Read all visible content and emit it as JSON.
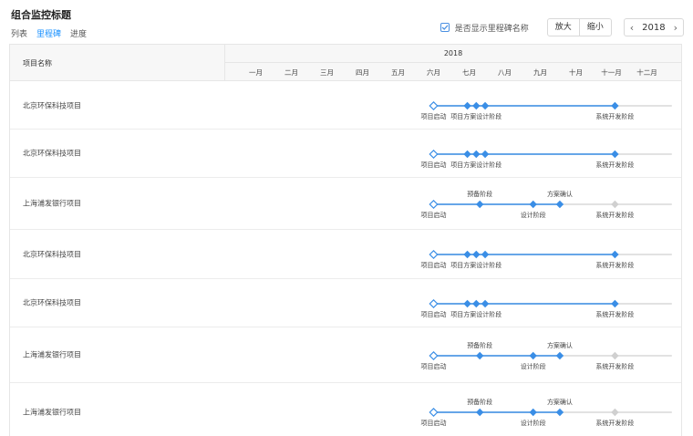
{
  "page_title": "组合监控标题",
  "tabs": [
    {
      "label": "列表",
      "active": false
    },
    {
      "label": "里程碑",
      "active": true
    },
    {
      "label": "进度",
      "active": false
    }
  ],
  "toolbar": {
    "show_milestone_names_label": "是否显示里程碑名称",
    "show_milestone_names_checked": true,
    "zoom_in_label": "放大",
    "zoom_out_label": "缩小",
    "prev_icon": "chevron-left-icon",
    "next_icon": "chevron-right-icon",
    "year": "2018"
  },
  "table": {
    "name_header": "项目名称",
    "year_header": "2018",
    "months": [
      "一月",
      "二月",
      "三月",
      "四月",
      "五月",
      "六月",
      "七月",
      "八月",
      "九月",
      "十月",
      "十一月",
      "十二月"
    ]
  },
  "colors": {
    "accent": "#1890ff",
    "milestone_done": "#3a8ee6",
    "milestone_pending": "#d0d0d0",
    "track_pending": "#d9d9d9"
  },
  "rows": [
    {
      "name": "北京环保科技项目",
      "progress_month": 10.6,
      "milestones": [
        {
          "month": 5.5,
          "status": "start",
          "label": "项目启动",
          "label_pos": "below"
        },
        {
          "month": 6.45,
          "status": "done",
          "label": "",
          "label_pos": "below"
        },
        {
          "month": 6.7,
          "status": "done",
          "label": "项目方案设计阶段",
          "label_pos": "below"
        },
        {
          "month": 6.95,
          "status": "done",
          "label": "",
          "label_pos": "below"
        },
        {
          "month": 10.6,
          "status": "done",
          "label": "系统开发阶段",
          "label_pos": "below"
        }
      ]
    },
    {
      "name": "北京环保科技项目",
      "progress_month": 10.6,
      "milestones": [
        {
          "month": 5.5,
          "status": "start",
          "label": "项目启动",
          "label_pos": "below"
        },
        {
          "month": 6.45,
          "status": "done",
          "label": "",
          "label_pos": "below"
        },
        {
          "month": 6.7,
          "status": "done",
          "label": "项目方案设计阶段",
          "label_pos": "below"
        },
        {
          "month": 6.95,
          "status": "done",
          "label": "",
          "label_pos": "below"
        },
        {
          "month": 10.6,
          "status": "done",
          "label": "系统开发阶段",
          "label_pos": "below"
        }
      ]
    },
    {
      "name": "上海浦发银行项目",
      "progress_month": 9.05,
      "milestones": [
        {
          "month": 5.5,
          "status": "start",
          "label": "项目启动",
          "label_pos": "below"
        },
        {
          "month": 6.8,
          "status": "done",
          "label": "预备阶段",
          "label_pos": "above"
        },
        {
          "month": 8.3,
          "status": "done",
          "label": "设计阶段",
          "label_pos": "below"
        },
        {
          "month": 9.05,
          "status": "done",
          "label": "方案确认",
          "label_pos": "above"
        },
        {
          "month": 10.6,
          "status": "pending",
          "label": "系统开发阶段",
          "label_pos": "below"
        }
      ]
    },
    {
      "name": "北京环保科技项目",
      "progress_month": 10.6,
      "milestones": [
        {
          "month": 5.5,
          "status": "start",
          "label": "项目启动",
          "label_pos": "below"
        },
        {
          "month": 6.45,
          "status": "done",
          "label": "",
          "label_pos": "below"
        },
        {
          "month": 6.7,
          "status": "done",
          "label": "项目方案设计阶段",
          "label_pos": "below"
        },
        {
          "month": 6.95,
          "status": "done",
          "label": "",
          "label_pos": "below"
        },
        {
          "month": 10.6,
          "status": "done",
          "label": "系统开发阶段",
          "label_pos": "below"
        }
      ]
    },
    {
      "name": "北京环保科技项目",
      "progress_month": 10.6,
      "milestones": [
        {
          "month": 5.5,
          "status": "start",
          "label": "项目启动",
          "label_pos": "below"
        },
        {
          "month": 6.45,
          "status": "done",
          "label": "",
          "label_pos": "below"
        },
        {
          "month": 6.7,
          "status": "done",
          "label": "项目方案设计阶段",
          "label_pos": "below"
        },
        {
          "month": 6.95,
          "status": "done",
          "label": "",
          "label_pos": "below"
        },
        {
          "month": 10.6,
          "status": "done",
          "label": "系统开发阶段",
          "label_pos": "below"
        }
      ]
    },
    {
      "name": "上海浦发银行项目",
      "progress_month": 9.05,
      "milestones": [
        {
          "month": 5.5,
          "status": "start",
          "label": "项目启动",
          "label_pos": "below"
        },
        {
          "month": 6.8,
          "status": "done",
          "label": "预备阶段",
          "label_pos": "above"
        },
        {
          "month": 8.3,
          "status": "done",
          "label": "设计阶段",
          "label_pos": "below"
        },
        {
          "month": 9.05,
          "status": "done",
          "label": "方案确认",
          "label_pos": "above"
        },
        {
          "month": 10.6,
          "status": "pending",
          "label": "系统开发阶段",
          "label_pos": "below"
        }
      ]
    },
    {
      "name": "上海浦发银行项目",
      "progress_month": 9.05,
      "milestones": [
        {
          "month": 5.5,
          "status": "start",
          "label": "项目启动",
          "label_pos": "below"
        },
        {
          "month": 6.8,
          "status": "done",
          "label": "预备阶段",
          "label_pos": "above"
        },
        {
          "month": 8.3,
          "status": "done",
          "label": "设计阶段",
          "label_pos": "below"
        },
        {
          "month": 9.05,
          "status": "done",
          "label": "方案确认",
          "label_pos": "above"
        },
        {
          "month": 10.6,
          "status": "pending",
          "label": "系统开发阶段",
          "label_pos": "below"
        }
      ]
    }
  ]
}
